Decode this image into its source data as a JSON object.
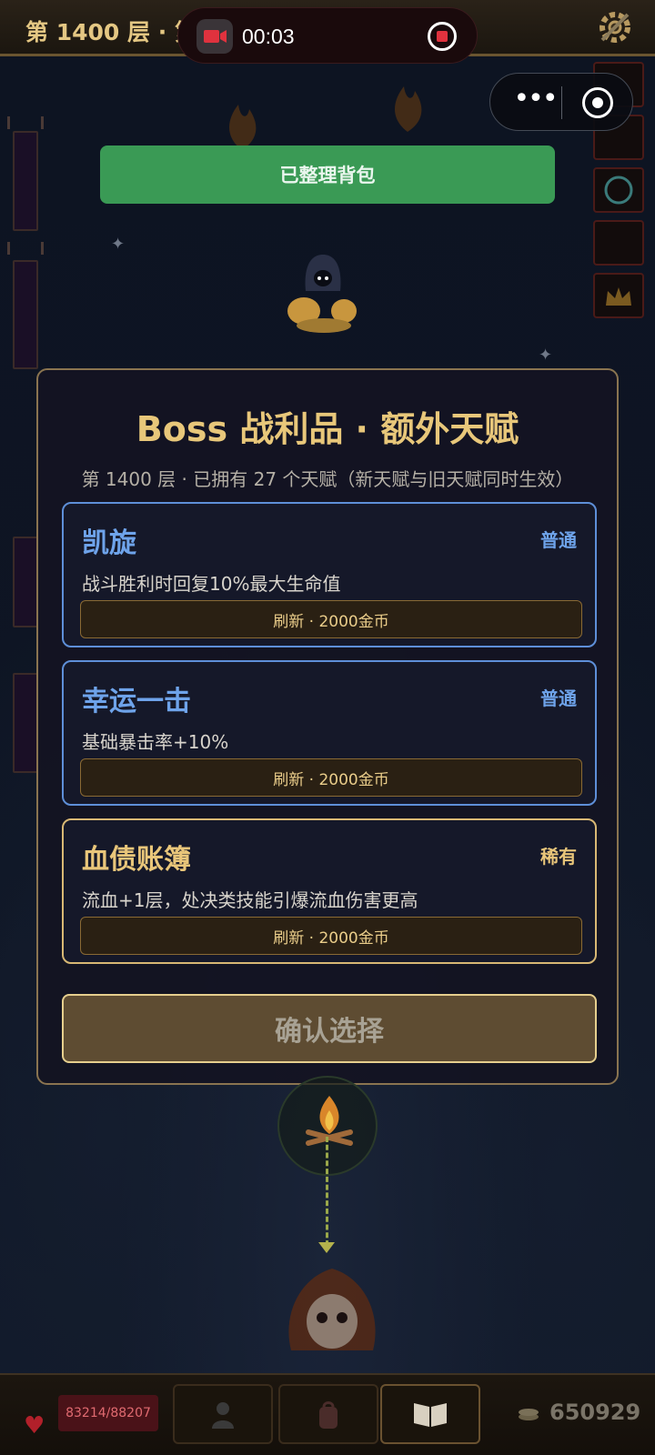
{
  "header": {
    "floor_title": "第 1400 层 · 第"
  },
  "recorder": {
    "time": "00:03"
  },
  "actions": {
    "sorted_bag_label": "已整理背包"
  },
  "modal": {
    "title": "Boss 战利品 · 额外天赋",
    "subtitle": "第 1400 层 · 已拥有 27 个天赋（新天赋与旧天赋同时生效）",
    "cards": [
      {
        "name": "凯旋",
        "rarity": "普通",
        "description": "战斗胜利时回复10%最大生命值",
        "refresh_label": "刷新 · 2000金币"
      },
      {
        "name": "幸运一击",
        "rarity": "普通",
        "description": "基础暴击率+10%",
        "refresh_label": "刷新 · 2000金币"
      },
      {
        "name": "血债账簿",
        "rarity": "稀有",
        "description": "流血+1层，处决类技能引爆流血伤害更高",
        "refresh_label": "刷新 · 2000金币"
      }
    ],
    "confirm_label": "确认选择"
  },
  "footer": {
    "hp": "83214/88207",
    "gold": "650929",
    "tabs": [
      "hero-icon",
      "backpack-icon",
      "book-icon"
    ]
  },
  "colors": {
    "common_rarity": "#6ea3ea",
    "rare_rarity": "#e9c67a",
    "accent_gold": "#e8c77a",
    "green_button": "#3a9a55"
  }
}
